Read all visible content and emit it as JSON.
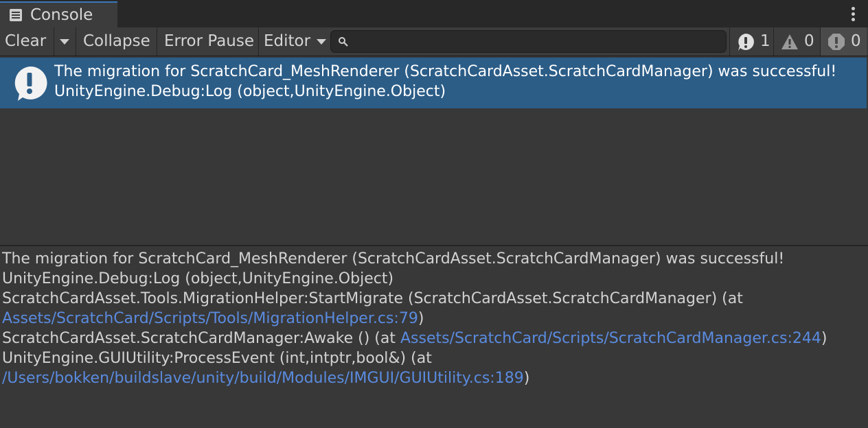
{
  "tab": {
    "label": "Console",
    "icon": "console-list-icon"
  },
  "toolbar": {
    "clear_label": "Clear",
    "collapse_label": "Collapse",
    "error_pause_label": "Error Pause",
    "editor_label": "Editor",
    "search": {
      "value": "",
      "placeholder": ""
    },
    "counters": {
      "info": "1",
      "warnings": "0",
      "errors": "0"
    }
  },
  "log_entry": {
    "line1": "The migration for ScratchCard_MeshRenderer (ScratchCardAsset.ScratchCardManager) was successful!",
    "line2": "UnityEngine.Debug:Log (object,UnityEngine.Object)"
  },
  "detail": {
    "line1": "The migration for ScratchCard_MeshRenderer (ScratchCardAsset.ScratchCardManager) was successful!",
    "line2": "UnityEngine.Debug:Log (object,UnityEngine.Object)",
    "line3": "ScratchCardAsset.Tools.MigrationHelper:StartMigrate (ScratchCardAsset.ScratchCardManager) (at",
    "line4_link": "Assets/ScratchCard/Scripts/Tools/MigrationHelper.cs:79",
    "line4_suffix": ")",
    "line5_prefix": "ScratchCardAsset.ScratchCardManager:Awake () (at ",
    "line5_link": "Assets/ScratchCard/Scripts/ScratchCardManager.cs:244",
    "line5_suffix": ")",
    "line6": "UnityEngine.GUIUtility:ProcessEvent (int,intptr,bool&) (at",
    "line7_link": "/Users/bokken/buildslave/unity/build/Modules/IMGUI/GUIUtility.cs:189",
    "line7_suffix": ")"
  },
  "colors": {
    "selected_row": "#2c5d87",
    "link": "#5a8be0",
    "background": "#383838"
  }
}
